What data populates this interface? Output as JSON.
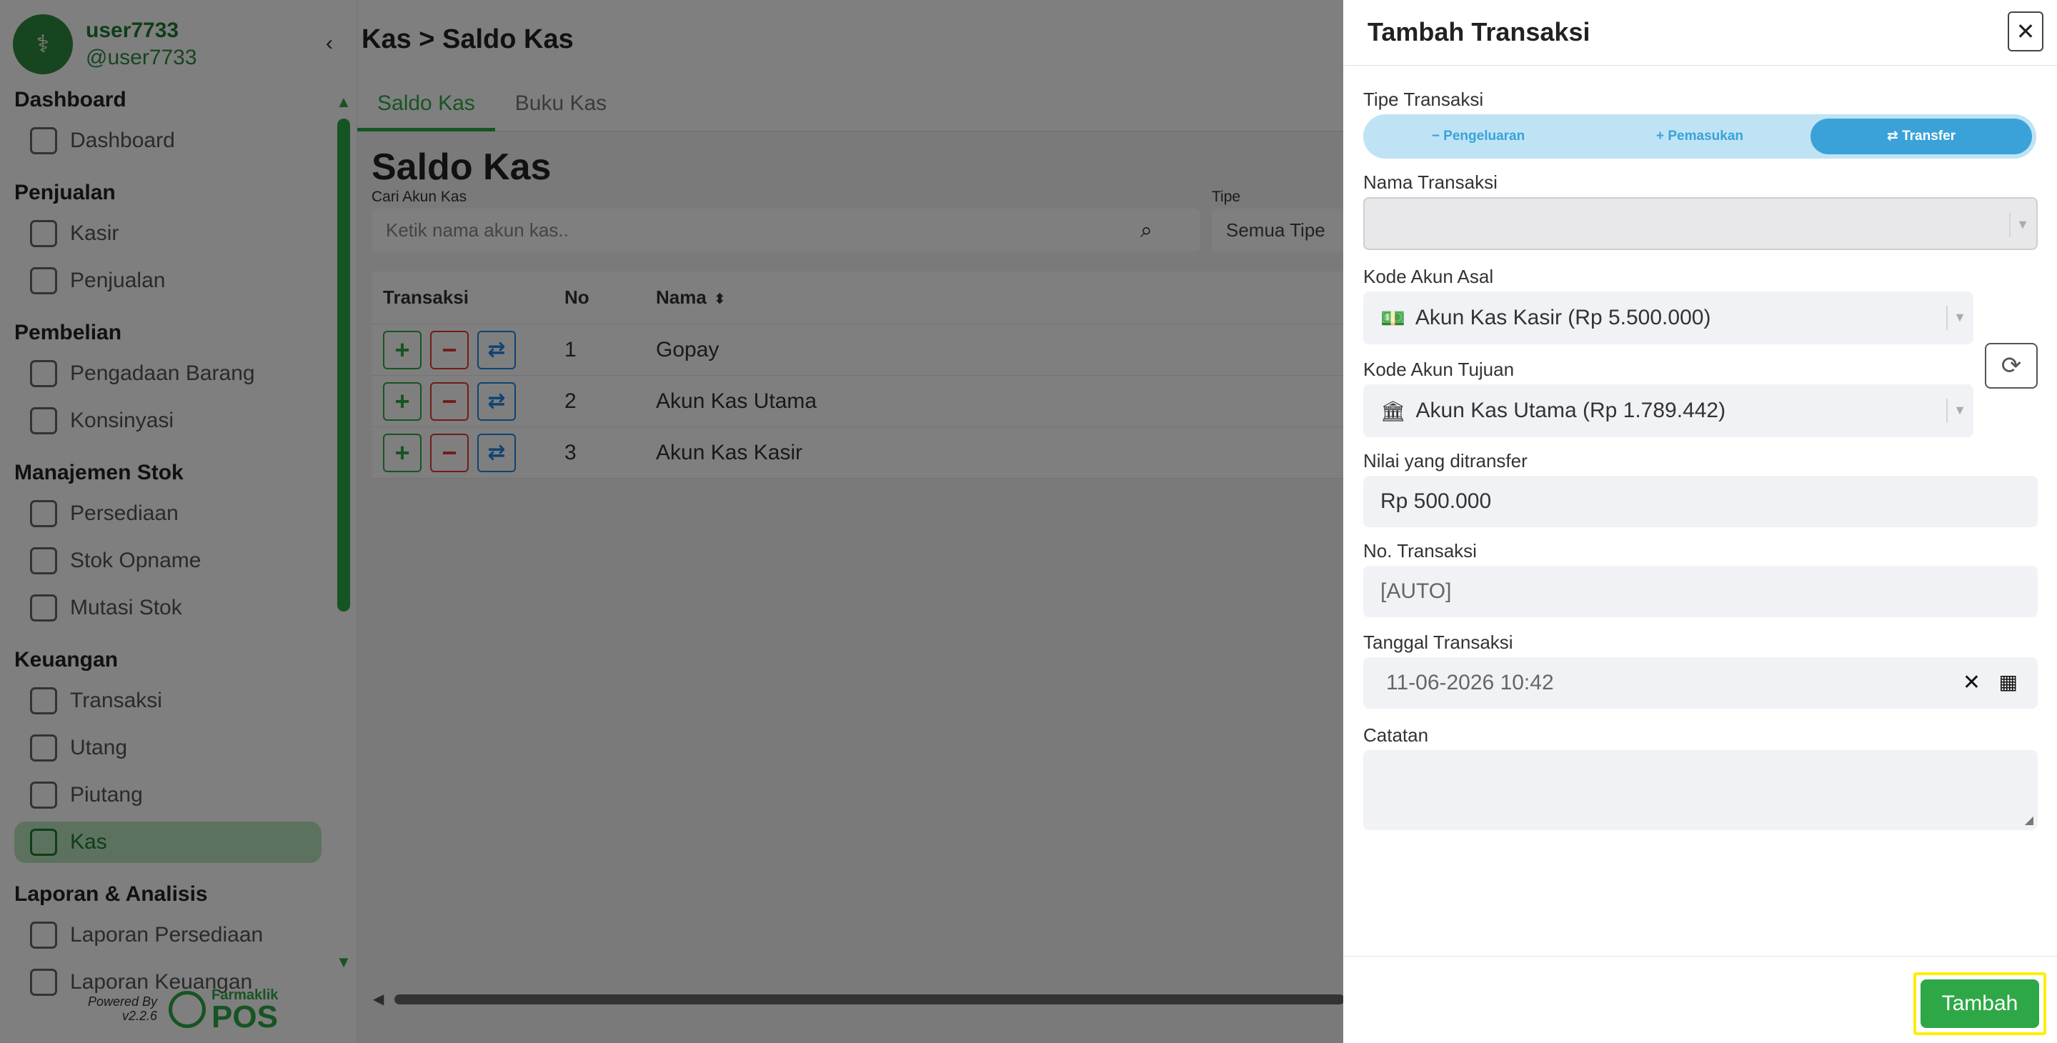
{
  "user": {
    "name": "user7733",
    "handle": "@user7733"
  },
  "nav": [
    {
      "section": "Dashboard",
      "items": [
        {
          "label": "Dashboard",
          "icon": "grid-icon"
        }
      ]
    },
    {
      "section": "Penjualan",
      "items": [
        {
          "label": "Kasir",
          "icon": "cash-register-icon"
        },
        {
          "label": "Penjualan",
          "icon": "basket-icon"
        }
      ]
    },
    {
      "section": "Pembelian",
      "items": [
        {
          "label": "Pengadaan Barang",
          "icon": "procurement-icon"
        },
        {
          "label": "Konsinyasi",
          "icon": "archive-icon"
        }
      ]
    },
    {
      "section": "Manajemen Stok",
      "items": [
        {
          "label": "Persediaan",
          "icon": "box-icon"
        },
        {
          "label": "Stok Opname",
          "icon": "box-icon"
        },
        {
          "label": "Mutasi Stok",
          "icon": "box-icon"
        }
      ]
    },
    {
      "section": "Keuangan",
      "items": [
        {
          "label": "Transaksi",
          "icon": "exchange-icon"
        },
        {
          "label": "Utang",
          "icon": "receipt-icon"
        },
        {
          "label": "Piutang",
          "icon": "receipt-icon"
        },
        {
          "label": "Kas",
          "icon": "exchange-icon",
          "active": true
        }
      ]
    },
    {
      "section": "Laporan & Analisis",
      "items": [
        {
          "label": "Laporan Persediaan",
          "icon": "clipboard-icon"
        },
        {
          "label": "Laporan Keuangan",
          "icon": "clipboard-icon"
        }
      ]
    }
  ],
  "footer": {
    "powered_by": "Powered By",
    "version": "v2.2.6",
    "brand_small": "Farmaklik",
    "brand_big": "POS"
  },
  "main": {
    "breadcrumb": "Kas > Saldo Kas",
    "tabs": [
      "Saldo Kas",
      "Buku Kas"
    ],
    "title": "Saldo Kas",
    "search_label": "Cari Akun Kas",
    "search_placeholder": "Ketik nama akun kas..",
    "type_label": "Tipe",
    "type_value": "Semua Tipe",
    "columns": [
      "Transaksi",
      "No",
      "Nama"
    ],
    "rows": [
      {
        "no": "1",
        "nama": "Gopay"
      },
      {
        "no": "2",
        "nama": "Akun Kas Utama"
      },
      {
        "no": "3",
        "nama": "Akun Kas Kasir"
      }
    ],
    "action_symbols": {
      "plus": "+",
      "minus": "−",
      "transfer": "⇄"
    }
  },
  "panel": {
    "title": "Tambah Transaksi",
    "close": "✕",
    "tipe_label": "Tipe Transaksi",
    "tipe_options": [
      {
        "label": "Pengeluaran",
        "icon": "−"
      },
      {
        "label": "Pemasukan",
        "icon": "+"
      },
      {
        "label": "Transfer",
        "icon": "⇄",
        "active": true
      }
    ],
    "nama_label": "Nama Transaksi",
    "nama_value": "",
    "asal_label": "Kode Akun Asal",
    "asal_value": "Akun Kas Kasir (Rp 5.500.000)",
    "tujuan_label": "Kode Akun Tujuan",
    "tujuan_value": "Akun Kas Utama (Rp 1.789.442)",
    "nilai_label": "Nilai yang ditransfer",
    "nilai_value": "Rp 500.000",
    "no_label": "No. Transaksi",
    "no_value": "[AUTO]",
    "tanggal_label": "Tanggal Transaksi",
    "tanggal_value": "11-06-2026 10:42",
    "catatan_label": "Catatan",
    "catatan_value": "",
    "submit": "Tambah"
  }
}
